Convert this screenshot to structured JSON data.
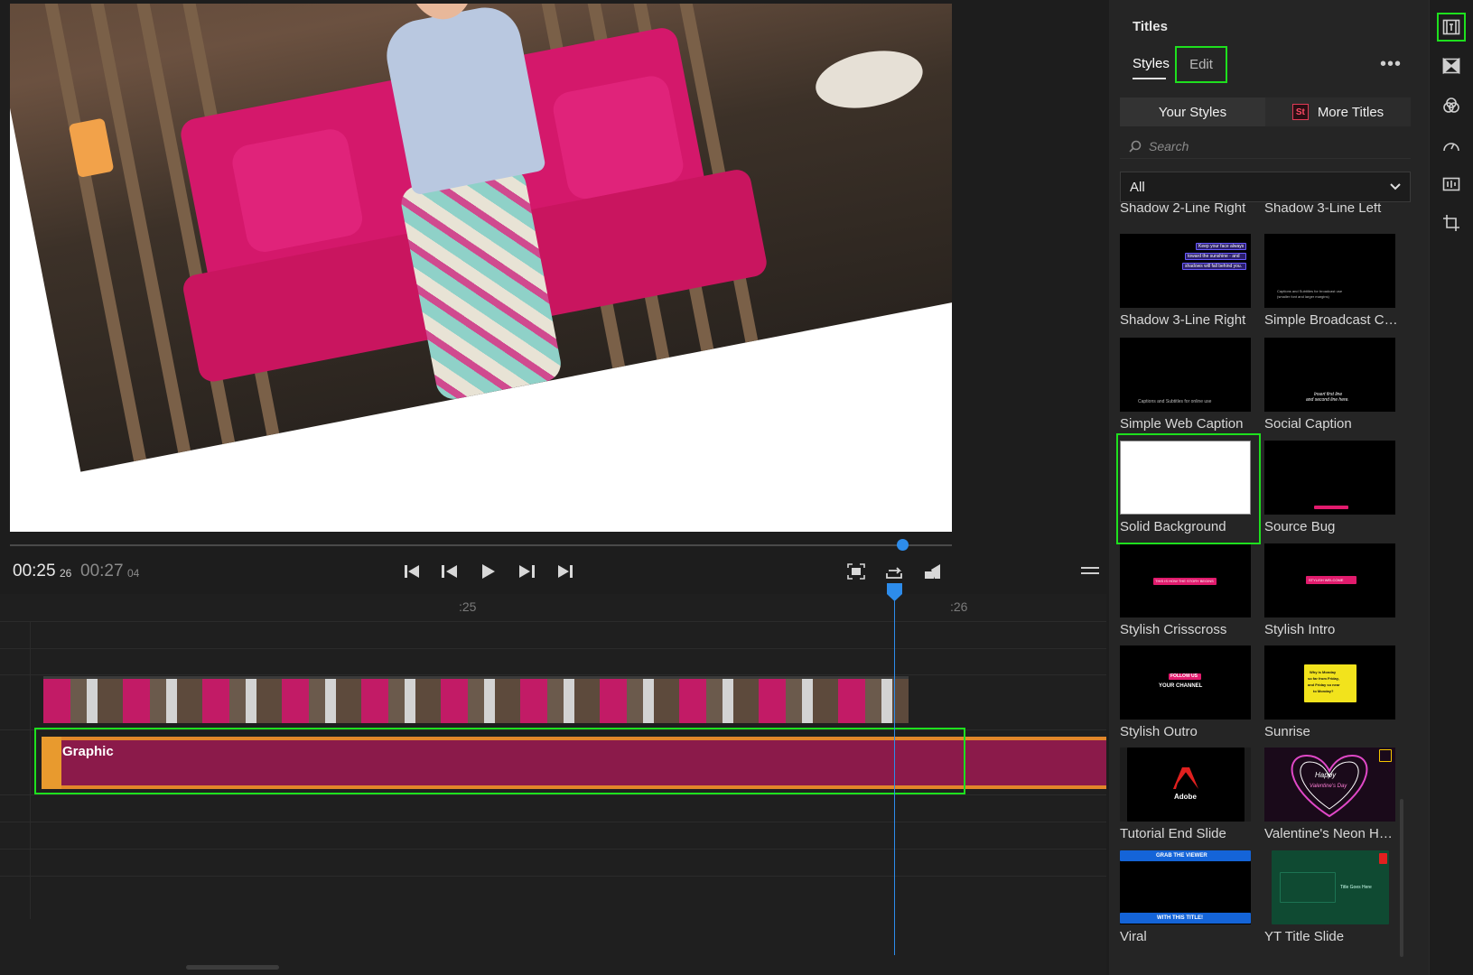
{
  "monitor": {
    "timecode_current": "00:25",
    "timecode_current_frames": "26",
    "timecode_duration": "00:27",
    "timecode_duration_frames": "04"
  },
  "timeline": {
    "ruler_labels": [
      ":25",
      ":26"
    ],
    "graphic_clip_label": "Graphic"
  },
  "panel": {
    "title": "Titles",
    "tabs": [
      "Styles",
      "Edit"
    ],
    "active_tab": "Styles",
    "segments": [
      "Your Styles",
      "More Titles"
    ],
    "more_titles_badge": "St",
    "search_placeholder": "Search",
    "filter_value": "All",
    "styles": [
      {
        "label": "Shadow 2-Line Right"
      },
      {
        "label": "Shadow 3-Line Left"
      },
      {
        "label": "Shadow 3-Line Right",
        "thumb_text": [
          "Keep your face always",
          "toward the sunshine - and",
          "shadows will fall behind you."
        ]
      },
      {
        "label": "Simple Broadcast Ca...",
        "thumb_text": [
          "Captions and Subtitles for broadcast use",
          "(smaller font and larger margins)"
        ]
      },
      {
        "label": "Simple Web Caption",
        "thumb_text": [
          "Captions and Subtitles for online use"
        ]
      },
      {
        "label": "Social Caption",
        "thumb_text": [
          "Insert first line",
          "and second line here."
        ]
      },
      {
        "label": "Solid Background"
      },
      {
        "label": "Source Bug"
      },
      {
        "label": "Stylish Crisscross",
        "thumb_text": [
          "THIS IS HOW THE STORY BEGINS"
        ]
      },
      {
        "label": "Stylish Intro",
        "thumb_text": [
          "STYLISH WELCOME"
        ]
      },
      {
        "label": "Stylish Outro",
        "thumb_text": [
          "FOLLOW US",
          "YOUR CHANNEL"
        ]
      },
      {
        "label": "Sunrise",
        "thumb_text": [
          "Why is Monday",
          "so far from Friday,",
          "and Friday so near",
          "to Monday?"
        ]
      },
      {
        "label": "Tutorial End Slide",
        "thumb_text": [
          "Adobe"
        ]
      },
      {
        "label": "Valentine's Neon Hea...",
        "thumb_text": [
          "Happy",
          "Valentine's Day"
        ]
      },
      {
        "label": "Viral",
        "thumb_text": [
          "GRAB THE VIEWER",
          "WITH THIS TITLE!"
        ]
      },
      {
        "label": "YT Title Slide",
        "thumb_text": [
          "Title Goes Here"
        ]
      }
    ]
  },
  "colors": {
    "accent": "#2d8ceb",
    "highlight": "#1ee01e",
    "graphic_clip": "#8b1a4a",
    "clip_border": "#e2862a"
  }
}
